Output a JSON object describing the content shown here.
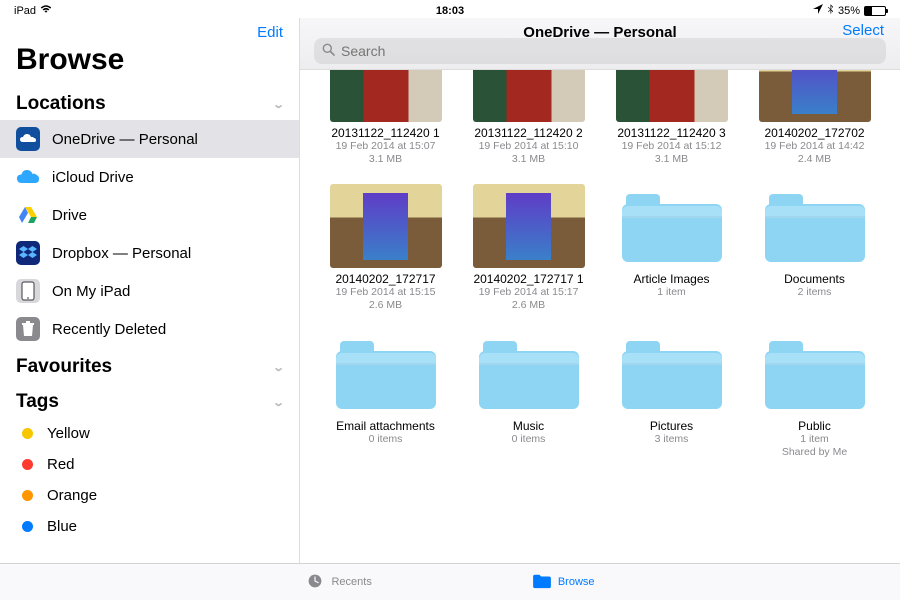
{
  "status": {
    "device": "iPad",
    "time": "18:03",
    "bluetooth": true,
    "battery_pct": "35%"
  },
  "sidebar": {
    "edit_label": "Edit",
    "title": "Browse",
    "locations_label": "Locations",
    "favourites_label": "Favourites",
    "tags_label": "Tags",
    "locations": [
      {
        "label": "OneDrive — Personal",
        "selected": true,
        "icon": "onedrive"
      },
      {
        "label": "iCloud Drive",
        "icon": "icloud"
      },
      {
        "label": "Drive",
        "icon": "gdrive"
      },
      {
        "label": "Dropbox — Personal",
        "icon": "dropbox"
      },
      {
        "label": "On My iPad",
        "icon": "ipad"
      },
      {
        "label": "Recently Deleted",
        "icon": "trash"
      }
    ],
    "tags": [
      {
        "label": "Yellow",
        "color": "#f7c600"
      },
      {
        "label": "Red",
        "color": "#ff3b30"
      },
      {
        "label": "Orange",
        "color": "#ff9500"
      },
      {
        "label": "Blue",
        "color": "#007aff"
      }
    ]
  },
  "main": {
    "title": "OneDrive — Personal",
    "select_label": "Select",
    "search_placeholder": "Search"
  },
  "items": [
    {
      "kind": "photo",
      "variant": "photo1",
      "name": "20131122_112420 1",
      "date": "19 Feb 2014 at 15:07",
      "size": "3.1 MB"
    },
    {
      "kind": "photo",
      "variant": "photo1",
      "name": "20131122_112420 2",
      "date": "19 Feb 2014 at 15:10",
      "size": "3.1 MB"
    },
    {
      "kind": "photo",
      "variant": "photo1",
      "name": "20131122_112420 3",
      "date": "19 Feb 2014 at 15:12",
      "size": "3.1 MB"
    },
    {
      "kind": "photo",
      "variant": "photo2",
      "name": "20140202_172702",
      "date": "19 Feb 2014 at 14:42",
      "size": "2.4 MB"
    },
    {
      "kind": "photo",
      "variant": "photo2",
      "name": "20140202_172717",
      "date": "19 Feb 2014 at 15:15",
      "size": "2.6 MB"
    },
    {
      "kind": "photo",
      "variant": "photo2",
      "name": "20140202_172717 1",
      "date": "19 Feb 2014 at 15:17",
      "size": "2.6 MB"
    },
    {
      "kind": "folder",
      "name": "Article Images",
      "meta": "1 item"
    },
    {
      "kind": "folder",
      "name": "Documents",
      "meta": "2 items"
    },
    {
      "kind": "folder",
      "name": "Email attachments",
      "meta": "0 items"
    },
    {
      "kind": "folder",
      "name": "Music",
      "meta": "0 items"
    },
    {
      "kind": "folder",
      "name": "Pictures",
      "meta": "3 items"
    },
    {
      "kind": "folder",
      "name": "Public",
      "meta": "1 item",
      "extra": "Shared by Me"
    }
  ],
  "tabbar": {
    "recents": "Recents",
    "browse": "Browse"
  }
}
